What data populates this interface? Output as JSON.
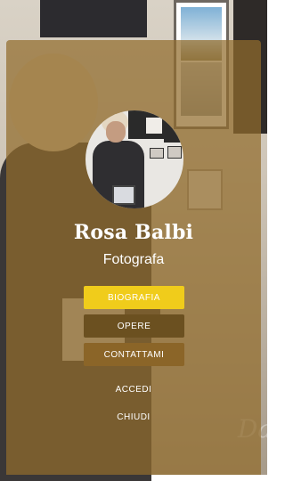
{
  "profile": {
    "name": "Rosa Balbi",
    "role": "Fotografa"
  },
  "menu": {
    "biografia": "BIOGRAFIA",
    "opere": "OPERE",
    "contattami": "CONTATTAMI",
    "accedi": "ACCEDI",
    "chiudi": "CHIUDI"
  },
  "colors": {
    "overlay": "#916c2d",
    "button_primary": "#f0cc1b",
    "button_dark": "#6b5020",
    "button_mid": "#8b6528",
    "text": "#ffffff"
  }
}
